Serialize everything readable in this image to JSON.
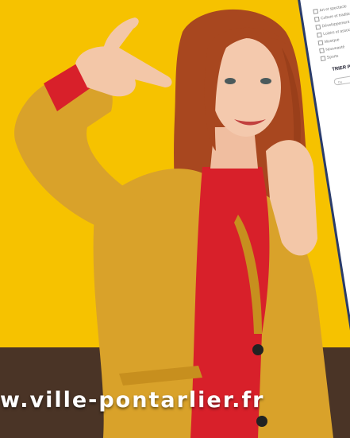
{
  "phone": {
    "items": [
      "Art et spectacle",
      "Culture et tradition",
      "Développement durable",
      "Loisirs et associations",
      "Musique",
      "Nouveauté",
      "Sports"
    ],
    "sort_title": "TRIER PAR D",
    "sort_value": "Du"
  },
  "banner": {
    "url": "w.ville-pontarlier.fr"
  },
  "colors": {
    "background_yellow": "#f6c200",
    "footer_brown": "#4a3426",
    "coat_mustard": "#d9a22a",
    "sweater_red": "#d8202a",
    "phone_frame": "#2a3c6b"
  }
}
